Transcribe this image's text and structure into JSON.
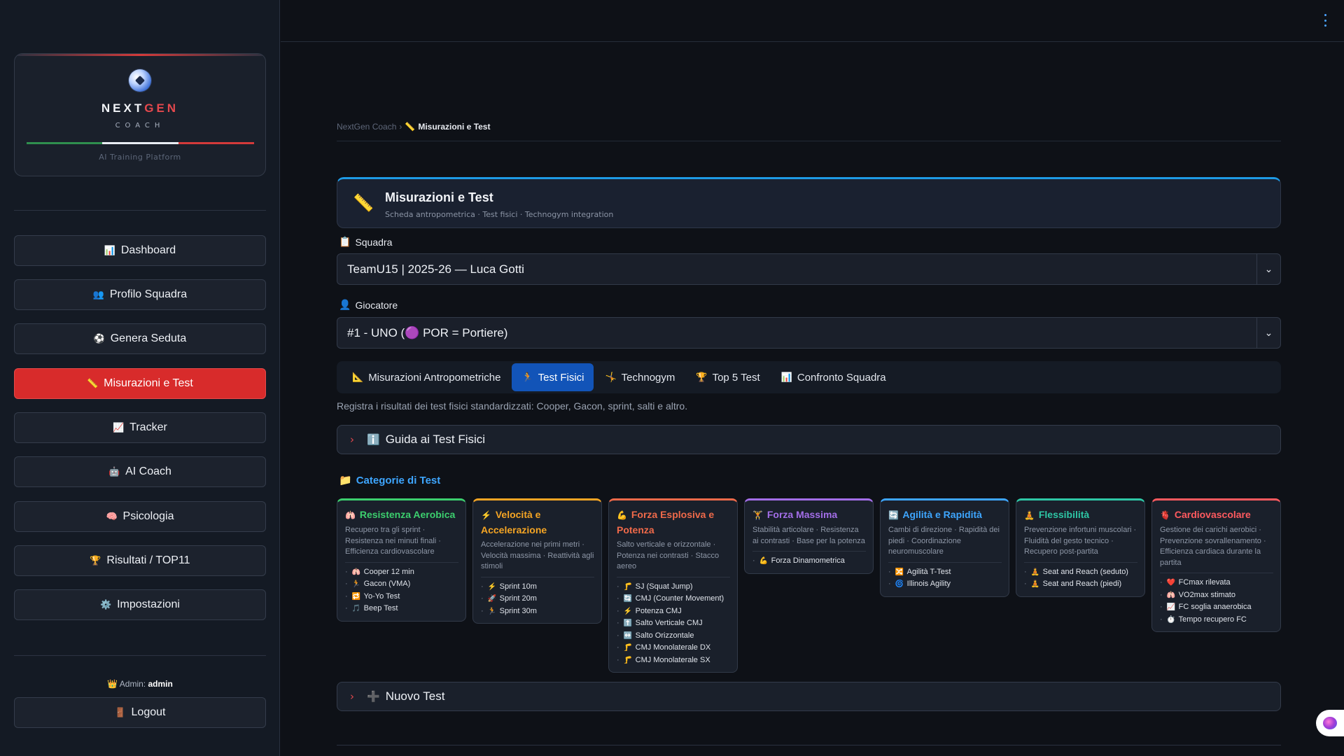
{
  "brand": {
    "name_part1": "NEXT",
    "name_part2": "GEN",
    "subtitle": "COACH",
    "tagline": "AI Training Platform",
    "logo_icon": "soccer-ball-icon"
  },
  "sidebar": {
    "items": [
      {
        "icon": "📊",
        "label": "Dashboard"
      },
      {
        "icon": "👥",
        "label": "Profilo Squadra"
      },
      {
        "icon": "⚽",
        "label": "Genera Seduta"
      },
      {
        "icon": "📏",
        "label": "Misurazioni e Test"
      },
      {
        "icon": "📈",
        "label": "Tracker"
      },
      {
        "icon": "🤖",
        "label": "AI Coach"
      },
      {
        "icon": "🧠",
        "label": "Psicologia"
      },
      {
        "icon": "🏆",
        "label": "Risultati / TOP11"
      },
      {
        "icon": "⚙️",
        "label": "Impostazioni"
      }
    ],
    "active_index": 3,
    "admin_icon": "👑",
    "admin_label": "Admin:",
    "admin_user": "admin",
    "logout_icon": "🚪",
    "logout_label": "Logout"
  },
  "breadcrumb": {
    "root": "NextGen Coach",
    "separator": "›",
    "current_icon": "📏",
    "current": "Misurazioni e Test"
  },
  "header": {
    "icon": "📏",
    "title": "Misurazioni e Test",
    "subtitle": "Scheda antropometrica · Test fisici · Technogym integration",
    "accent": "#1e9be6"
  },
  "squadra": {
    "icon": "📋",
    "label": "Squadra",
    "value": "TeamU15 | 2025-26 — Luca Gotti"
  },
  "giocatore": {
    "icon": "👤",
    "label": "Giocatore",
    "value": "#1 - UNO (🟣 POR = Portiere)"
  },
  "tabs": [
    {
      "icon": "📐",
      "label": "Misurazioni Antropometriche"
    },
    {
      "icon": "🏃",
      "label": "Test Fisici"
    },
    {
      "icon": "🤸",
      "label": "Technogym"
    },
    {
      "icon": "🏆",
      "label": "Top 5 Test"
    },
    {
      "icon": "📊",
      "label": "Confronto Squadra"
    }
  ],
  "active_tab": 1,
  "description": "Registra i risultati dei test fisici standardizzati: Cooper, Gacon, sprint, salti e altro.",
  "guide_expander": {
    "arrow": "›",
    "icon": "ℹ️",
    "label": "Guida ai Test Fisici"
  },
  "categories_heading": {
    "icon": "📁",
    "label": "Categorie di Test"
  },
  "categories": [
    {
      "icon": "🫁",
      "title": "Resistenza Aerobica",
      "color": "#3ccf6e",
      "desc": "Recupero tra gli sprint · Resistenza nei minuti finali · Efficienza cardiovascolare",
      "tests": [
        {
          "icon": "🫁",
          "label": "Cooper 12 min"
        },
        {
          "icon": "🏃",
          "label": "Gacon (VMA)"
        },
        {
          "icon": "🔁",
          "label": "Yo-Yo Test"
        },
        {
          "icon": "🎵",
          "label": "Beep Test"
        }
      ]
    },
    {
      "icon": "⚡",
      "title": "Velocità e Accelerazione",
      "color": "#f5a524",
      "desc": "Accelerazione nei primi metri · Velocità massima · Reattività agli stimoli",
      "tests": [
        {
          "icon": "⚡",
          "label": "Sprint 10m"
        },
        {
          "icon": "🚀",
          "label": "Sprint 20m"
        },
        {
          "icon": "🏃",
          "label": "Sprint 30m"
        }
      ]
    },
    {
      "icon": "💪",
      "title": "Forza Esplosiva e Potenza",
      "color": "#f06a4a",
      "desc": "Salto verticale e orizzontale · Potenza nei contrasti · Stacco aereo",
      "tests": [
        {
          "icon": "🦵",
          "label": "SJ (Squat Jump)"
        },
        {
          "icon": "🔄",
          "label": "CMJ (Counter Movement)"
        },
        {
          "icon": "⚡",
          "label": "Potenza CMJ"
        },
        {
          "icon": "⬆️",
          "label": "Salto Verticale CMJ"
        },
        {
          "icon": "↔️",
          "label": "Salto Orizzontale"
        },
        {
          "icon": "🦵",
          "label": "CMJ Monolaterale DX"
        },
        {
          "icon": "🦵",
          "label": "CMJ Monolaterale SX"
        }
      ]
    },
    {
      "icon": "🏋️",
      "title": "Forza Massima",
      "color": "#a36ee8",
      "desc": "Stabilità articolare · Resistenza ai contrasti · Base per la potenza",
      "tests": [
        {
          "icon": "💪",
          "label": "Forza Dinamometrica"
        }
      ]
    },
    {
      "icon": "🔄",
      "title": "Agilità e Rapidità",
      "color": "#3ea6ff",
      "desc": "Cambi di direzione · Rapidità dei piedi · Coordinazione neuromuscolare",
      "tests": [
        {
          "icon": "🔀",
          "label": "Agilità T-Test"
        },
        {
          "icon": "🌀",
          "label": "Illinois Agility"
        }
      ]
    },
    {
      "icon": "🧘",
      "title": "Flessibilità",
      "color": "#2ec7a6",
      "desc": "Prevenzione infortuni muscolari · Fluidità del gesto tecnico · Recupero post-partita",
      "tests": [
        {
          "icon": "🧘",
          "label": "Seat and Reach (seduto)"
        },
        {
          "icon": "🧘",
          "label": "Seat and Reach (piedi)"
        }
      ]
    },
    {
      "icon": "🫀",
      "title": "Cardiovascolare",
      "color": "#ff5a5f",
      "desc": "Gestione dei carichi aerobici · Prevenzione sovrallenamento · Efficienza cardiaca durante la partita",
      "tests": [
        {
          "icon": "❤️",
          "label": "FCmax rilevata"
        },
        {
          "icon": "🫁",
          "label": "VO2max stimato"
        },
        {
          "icon": "📈",
          "label": "FC soglia anaerobica"
        },
        {
          "icon": "⏱️",
          "label": "Tempo recupero FC"
        }
      ]
    }
  ],
  "new_test_expander": {
    "arrow": "›",
    "icon": "➕",
    "label": "Nuovo Test"
  },
  "colors": {
    "active_nav": "#d82b2b",
    "active_tab": "#1254b8",
    "expander_arrow": "#e5484d",
    "categories_heading": "#3ea6ff"
  }
}
